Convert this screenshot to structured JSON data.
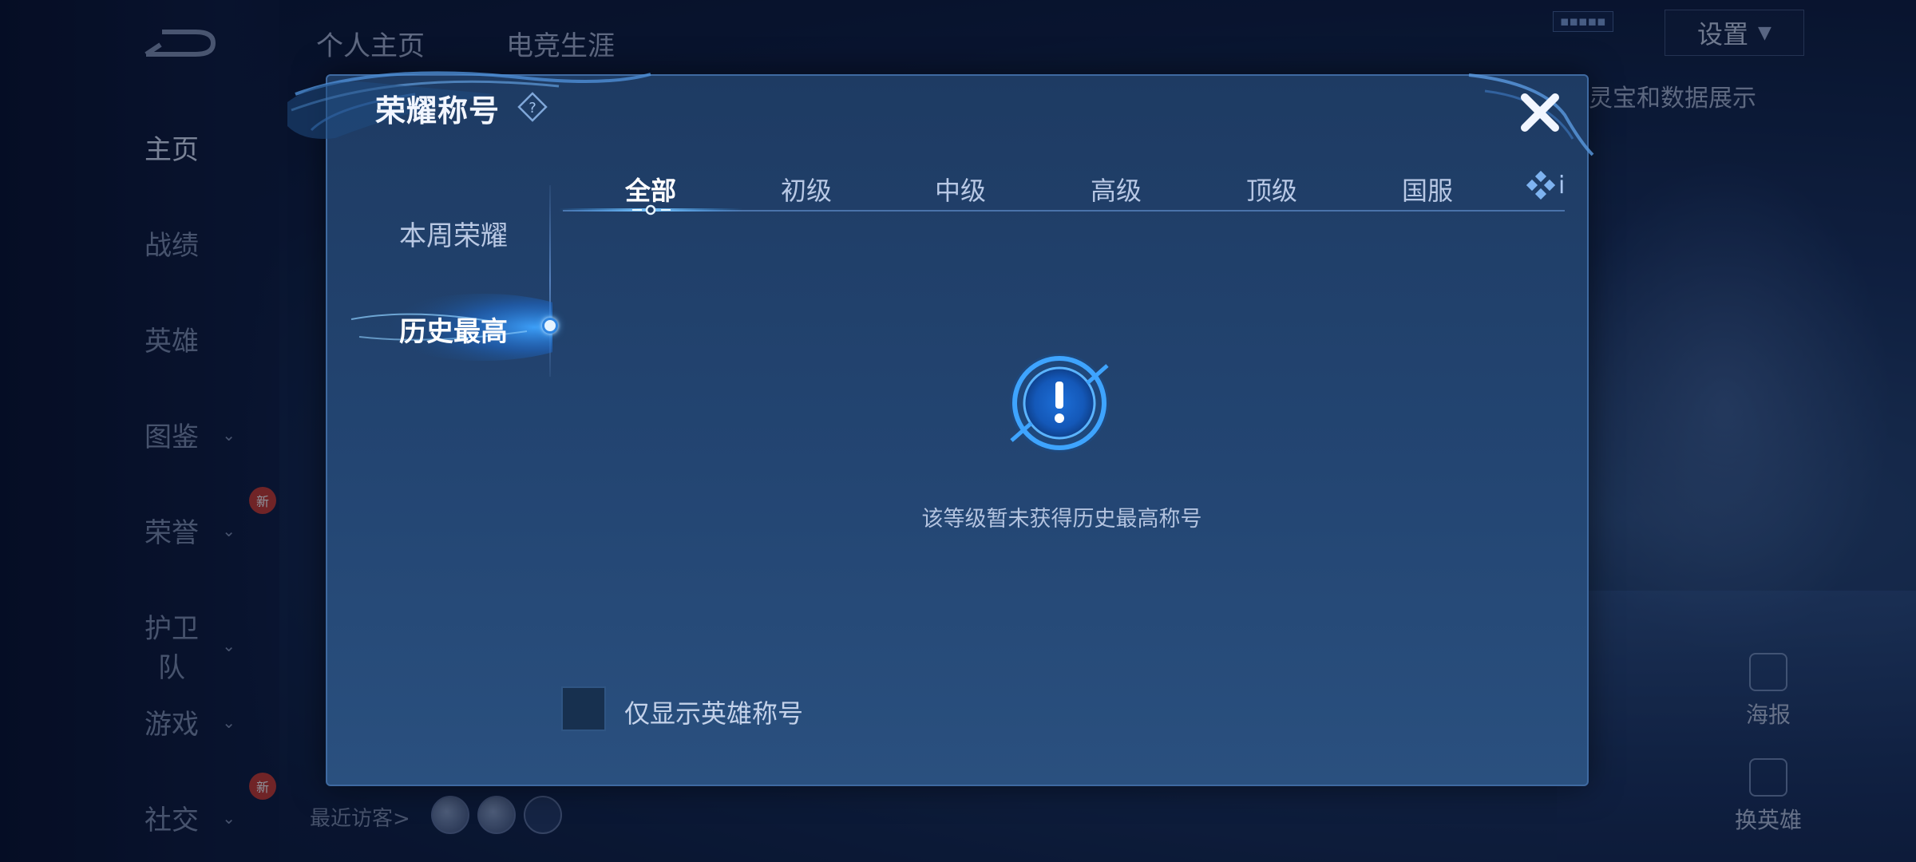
{
  "top_bar": {
    "tabs": [
      "个人主页",
      "电竞生涯"
    ],
    "settings_label": "设置",
    "background_caption": "灵宝和数据展示"
  },
  "sidebar": {
    "items": [
      {
        "label": "主页",
        "active": true,
        "has_arrow": false,
        "badge": ""
      },
      {
        "label": "战绩",
        "active": false,
        "has_arrow": false,
        "badge": ""
      },
      {
        "label": "英雄",
        "active": false,
        "has_arrow": false,
        "badge": ""
      },
      {
        "label": "图鉴",
        "active": false,
        "has_arrow": true,
        "badge": ""
      },
      {
        "label": "荣誉",
        "active": false,
        "has_arrow": true,
        "badge": "新"
      },
      {
        "label": "护卫队",
        "active": false,
        "has_arrow": true,
        "badge": ""
      },
      {
        "label": "游戏",
        "active": false,
        "has_arrow": true,
        "badge": ""
      },
      {
        "label": "社交",
        "active": false,
        "has_arrow": true,
        "badge": "新"
      }
    ]
  },
  "visitors": {
    "label": "最近访客>"
  },
  "right_actions": [
    {
      "label": "海报"
    },
    {
      "label": "换英雄"
    }
  ],
  "dialog": {
    "title": "荣耀称号",
    "categories": [
      {
        "label": "本周荣耀",
        "active": false
      },
      {
        "label": "历史最高",
        "active": true
      }
    ],
    "tabs": [
      {
        "label": "全部",
        "active": true
      },
      {
        "label": "初级",
        "active": false
      },
      {
        "label": "中级",
        "active": false
      },
      {
        "label": "高级",
        "active": false
      },
      {
        "label": "顶级",
        "active": false
      },
      {
        "label": "国服",
        "active": false
      }
    ],
    "tab_more_label": "i",
    "empty_message": "该等级暂未获得历史最高称号",
    "checkbox_label": "仅显示英雄称号",
    "checkbox_checked": false
  },
  "colors": {
    "accent": "#3a9bff",
    "dialog_bg": "#234572",
    "dialog_border": "#3f6aa1"
  }
}
